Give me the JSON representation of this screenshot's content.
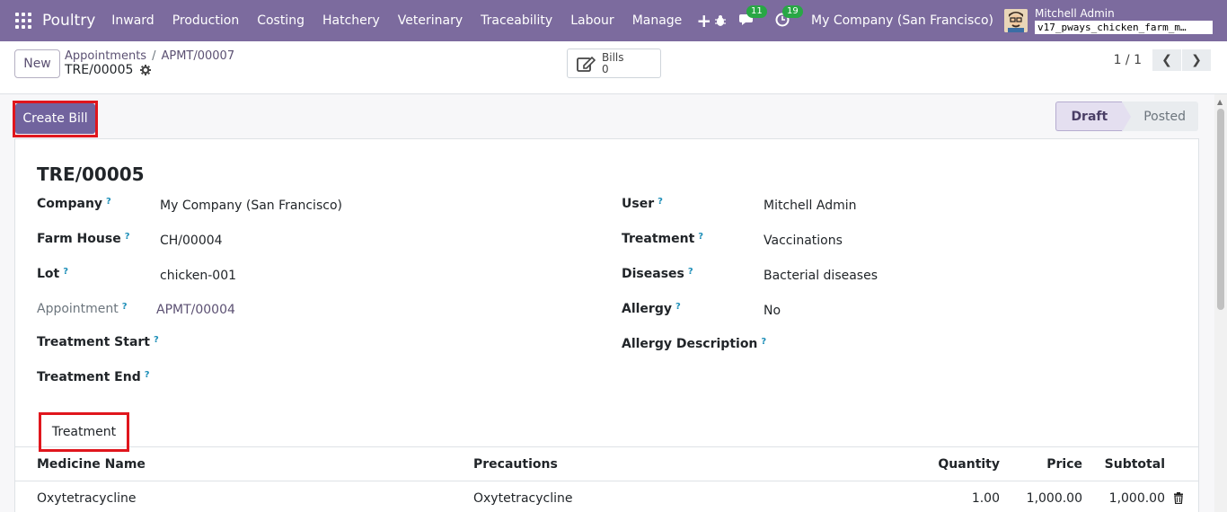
{
  "navbar": {
    "brand": "Poultry",
    "menu": [
      "Inward",
      "Production",
      "Costing",
      "Hatchery",
      "Veterinary",
      "Traceability",
      "Labour",
      "Manage"
    ],
    "messages_count": "11",
    "activities_count": "19",
    "company": "My Company (San Francisco)",
    "user_name": "Mitchell Admin",
    "database": "v17_pways_chicken_farm_m…"
  },
  "control": {
    "new_label": "New",
    "breadcrumb": [
      "Appointments",
      "APMT/00007"
    ],
    "record_name": "TRE/00005",
    "smart_button": {
      "label": "Bills",
      "count": "0"
    },
    "pager": "1 / 1"
  },
  "statusbar": {
    "create_bill_label": "Create Bill",
    "steps": [
      "Draft",
      "Posted"
    ],
    "active_step": "Draft"
  },
  "form": {
    "title": "TRE/00005",
    "left": {
      "company": {
        "label": "Company",
        "value": "My Company (San Francisco)"
      },
      "farm_house": {
        "label": "Farm House",
        "value": "CH/00004"
      },
      "lot": {
        "label": "Lot",
        "value": "chicken-001"
      },
      "appointment": {
        "label": "Appointment",
        "value": "APMT/00004"
      },
      "treatment_start": {
        "label": "Treatment Start",
        "value": ""
      },
      "treatment_end": {
        "label": "Treatment End",
        "value": ""
      }
    },
    "right": {
      "user": {
        "label": "User",
        "value": "Mitchell Admin"
      },
      "treatment": {
        "label": "Treatment",
        "value": "Vaccinations"
      },
      "diseases": {
        "label": "Diseases",
        "value": "Bacterial diseases"
      },
      "allergy": {
        "label": "Allergy",
        "value": "No"
      },
      "allergy_description": {
        "label": "Allergy Description",
        "value": ""
      }
    },
    "help_mark": "?",
    "tab_label": "Treatment",
    "table": {
      "columns": [
        "Medicine Name",
        "Precautions",
        "Quantity",
        "Price",
        "Subtotal"
      ],
      "rows": [
        {
          "medicine": "Oxytetracycline",
          "precautions": "Oxytetracycline",
          "quantity": "1.00",
          "price": "1,000.00",
          "subtotal": "1,000.00"
        }
      ]
    }
  },
  "colors": {
    "navbar": "#7c6b9e",
    "primary": "#71639e",
    "highlight": "#e0161d",
    "help": "#1e8fb8",
    "badge": "#28a745"
  }
}
